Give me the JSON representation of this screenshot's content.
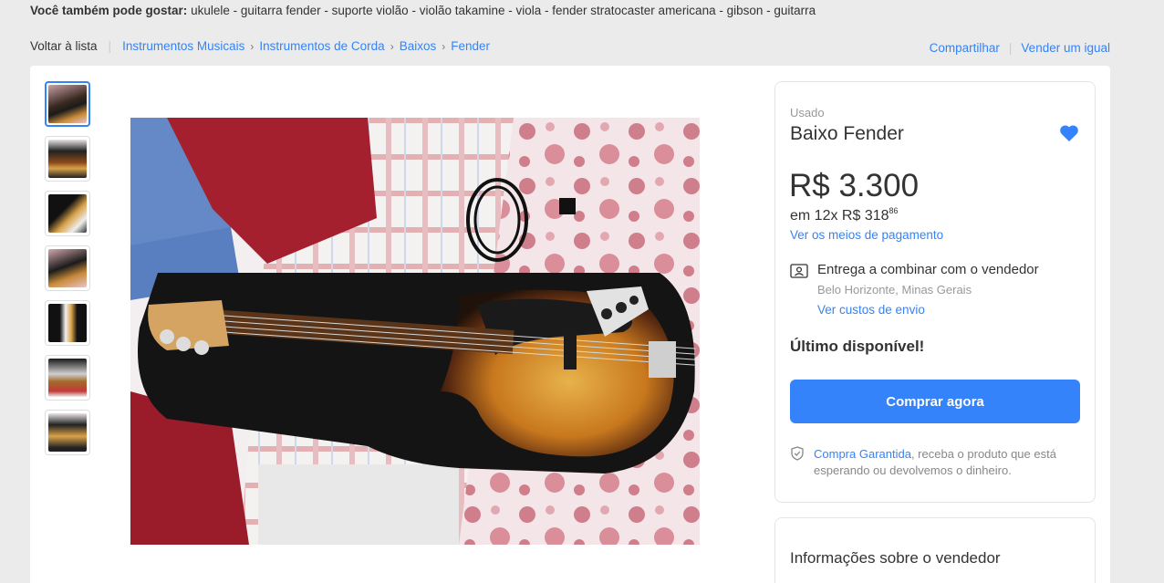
{
  "suggestions": {
    "label": "Você também pode gostar:",
    "items_text": "ukulele - guitarra fender - suporte violão - violão takamine - viola - fender stratocaster americana - gibson - guitarra"
  },
  "breadcrumb": {
    "back": "Voltar à lista",
    "items": [
      "Instrumentos Musicais",
      "Instrumentos de Corda",
      "Baixos",
      "Fender"
    ]
  },
  "actions": {
    "share": "Compartilhar",
    "sell_same": "Vender um igual"
  },
  "gallery": {
    "thumbnail_count": 7,
    "selected_index": 0
  },
  "product": {
    "condition": "Usado",
    "title": "Baixo Fender",
    "price": "R$ 3.300",
    "installments_prefix": "em 12x R$ 318",
    "installments_cents": "86",
    "payment_link": "Ver os meios de pagamento",
    "shipping_title": "Entrega a combinar com o vendedor",
    "shipping_location": "Belo Horizonte, Minas Gerais",
    "shipping_link": "Ver custos de envio",
    "stock": "Último disponível!",
    "buy_button": "Comprar agora",
    "guarantee_link": "Compra Garantida",
    "guarantee_text": ", receba o produto que está esperando ou devolvemos o dinheiro."
  },
  "seller": {
    "title": "Informações sobre o vendedor"
  },
  "colors": {
    "accent": "#3483fa",
    "background": "#ebebeb"
  }
}
